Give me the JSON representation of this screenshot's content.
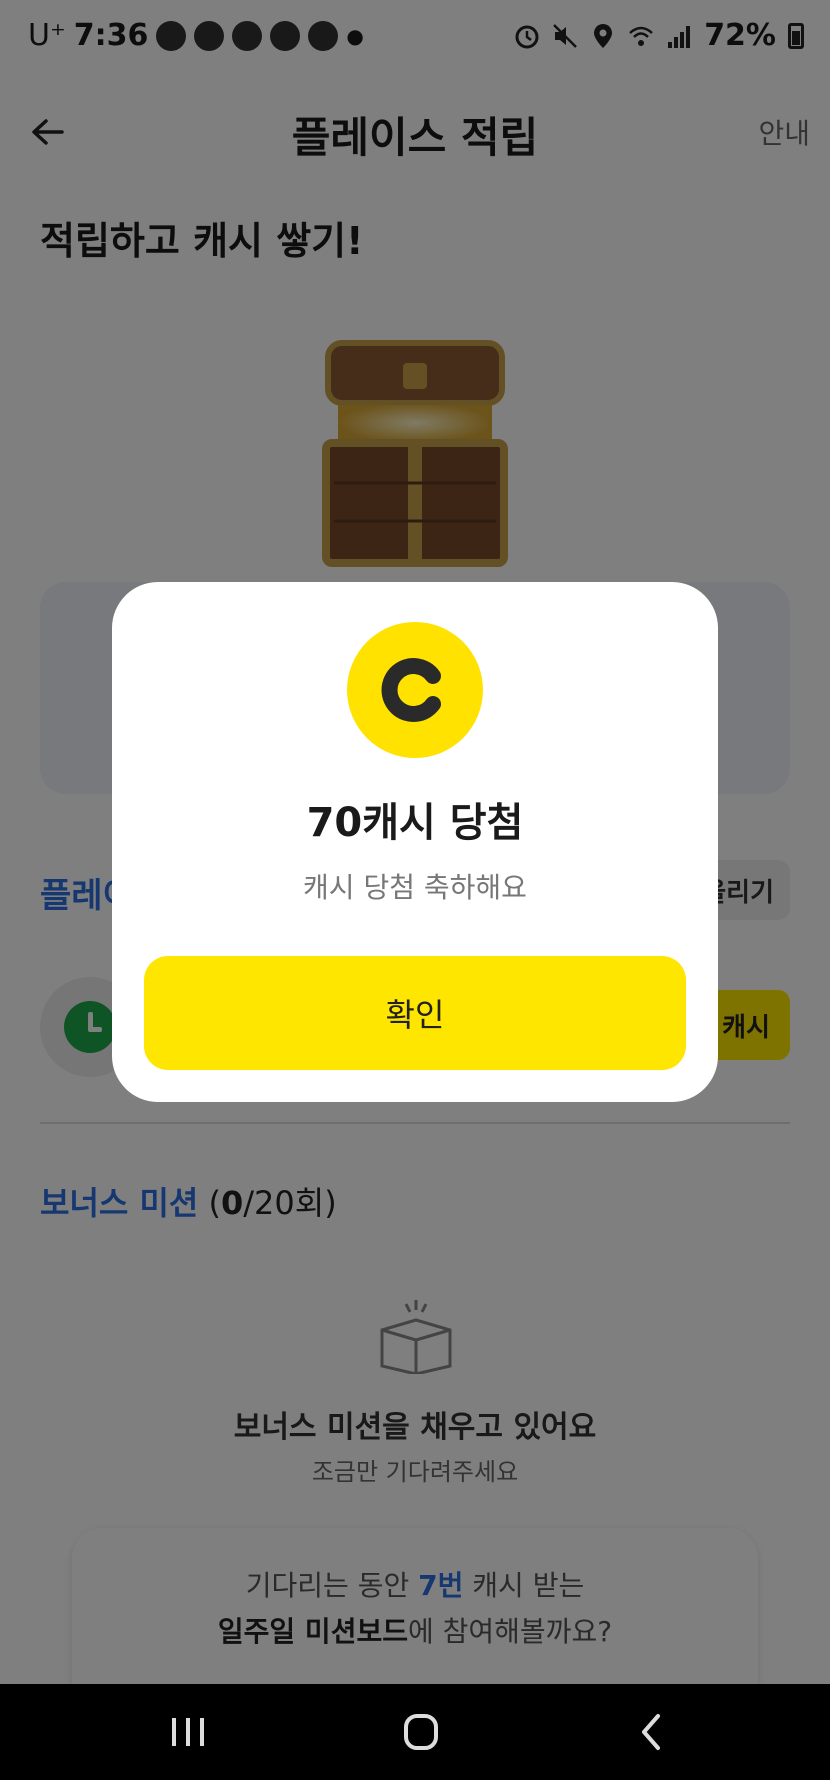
{
  "status_bar": {
    "carrier": "U⁺",
    "time": "7:36",
    "battery": "72%"
  },
  "header": {
    "title": "플레이스 적립",
    "info": "안내"
  },
  "hero": {
    "title": "적립하고 캐시 쌓기!"
  },
  "place": {
    "heading_visible": "플레이",
    "pull_label": "올리기",
    "cash_label": "캐시"
  },
  "bonus": {
    "label": "보너스 미션",
    "count_open": " (",
    "count_done": "0",
    "count_total": "/20회)",
    "filling_title": "보너스 미션을 채우고 있어요",
    "filling_sub": "조금만 기다려주세요"
  },
  "board": {
    "line1_pre": "기다리는 동안 ",
    "line1_times": "7번",
    "line1_post": " 캐시 받는",
    "line2_bold": "일주일 미션보드",
    "line2_post": "에 참여해볼까요?"
  },
  "modal": {
    "title": "70캐시 당첨",
    "subtitle": "캐시 당첨 축하해요",
    "confirm": "확인"
  },
  "colors": {
    "accent_yellow": "#ffe600",
    "accent_blue": "#2d6fe0",
    "overlay": "rgba(0,0,0,0.5)"
  },
  "icons": [
    "back-arrow-icon",
    "treasure-chest-icon",
    "clock-icon",
    "box-icon",
    "coin-icon"
  ]
}
